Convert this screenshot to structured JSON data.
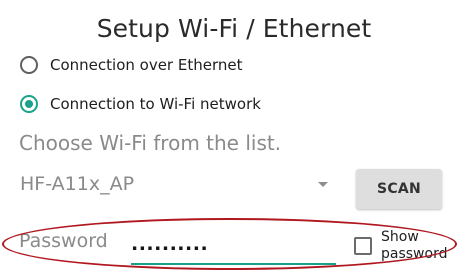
{
  "dialog": {
    "title": "Setup Wi-Fi / Ethernet"
  },
  "connection": {
    "options": [
      {
        "label": "Connection over Ethernet",
        "selected": false
      },
      {
        "label": "Connection to Wi-Fi network",
        "selected": true
      }
    ],
    "accent_color": "#1aa38a"
  },
  "wifi": {
    "hint": "Choose Wi-Fi from the list.",
    "selected_network": "HF-A11x_AP",
    "scan_label": "SCAN"
  },
  "password": {
    "label": "Password",
    "value": "..........",
    "show_label_line1": "Show",
    "show_label_line2": "password",
    "show_checked": false
  },
  "annotation": {
    "highlight_color": "#b0171f"
  }
}
